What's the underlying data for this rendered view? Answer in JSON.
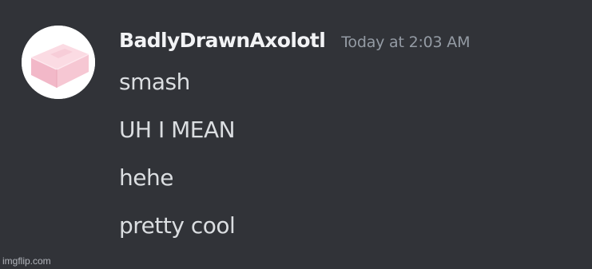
{
  "message": {
    "author": {
      "username": "BadlyDrawnAxolotl",
      "avatar_icon": "pink-eraser-avatar",
      "name_color": "#f2f3f5"
    },
    "timestamp": "Today at 2:03 AM",
    "lines": [
      "smash",
      "UH I MEAN",
      "hehe",
      "pretty cool"
    ]
  },
  "theme": {
    "background": "#313338",
    "text_color": "#dbdee1",
    "timestamp_color": "#949ba4",
    "avatar_background": "#ffffff",
    "eraser_color": "#f6c7d3"
  },
  "watermark": "imgflip.com"
}
